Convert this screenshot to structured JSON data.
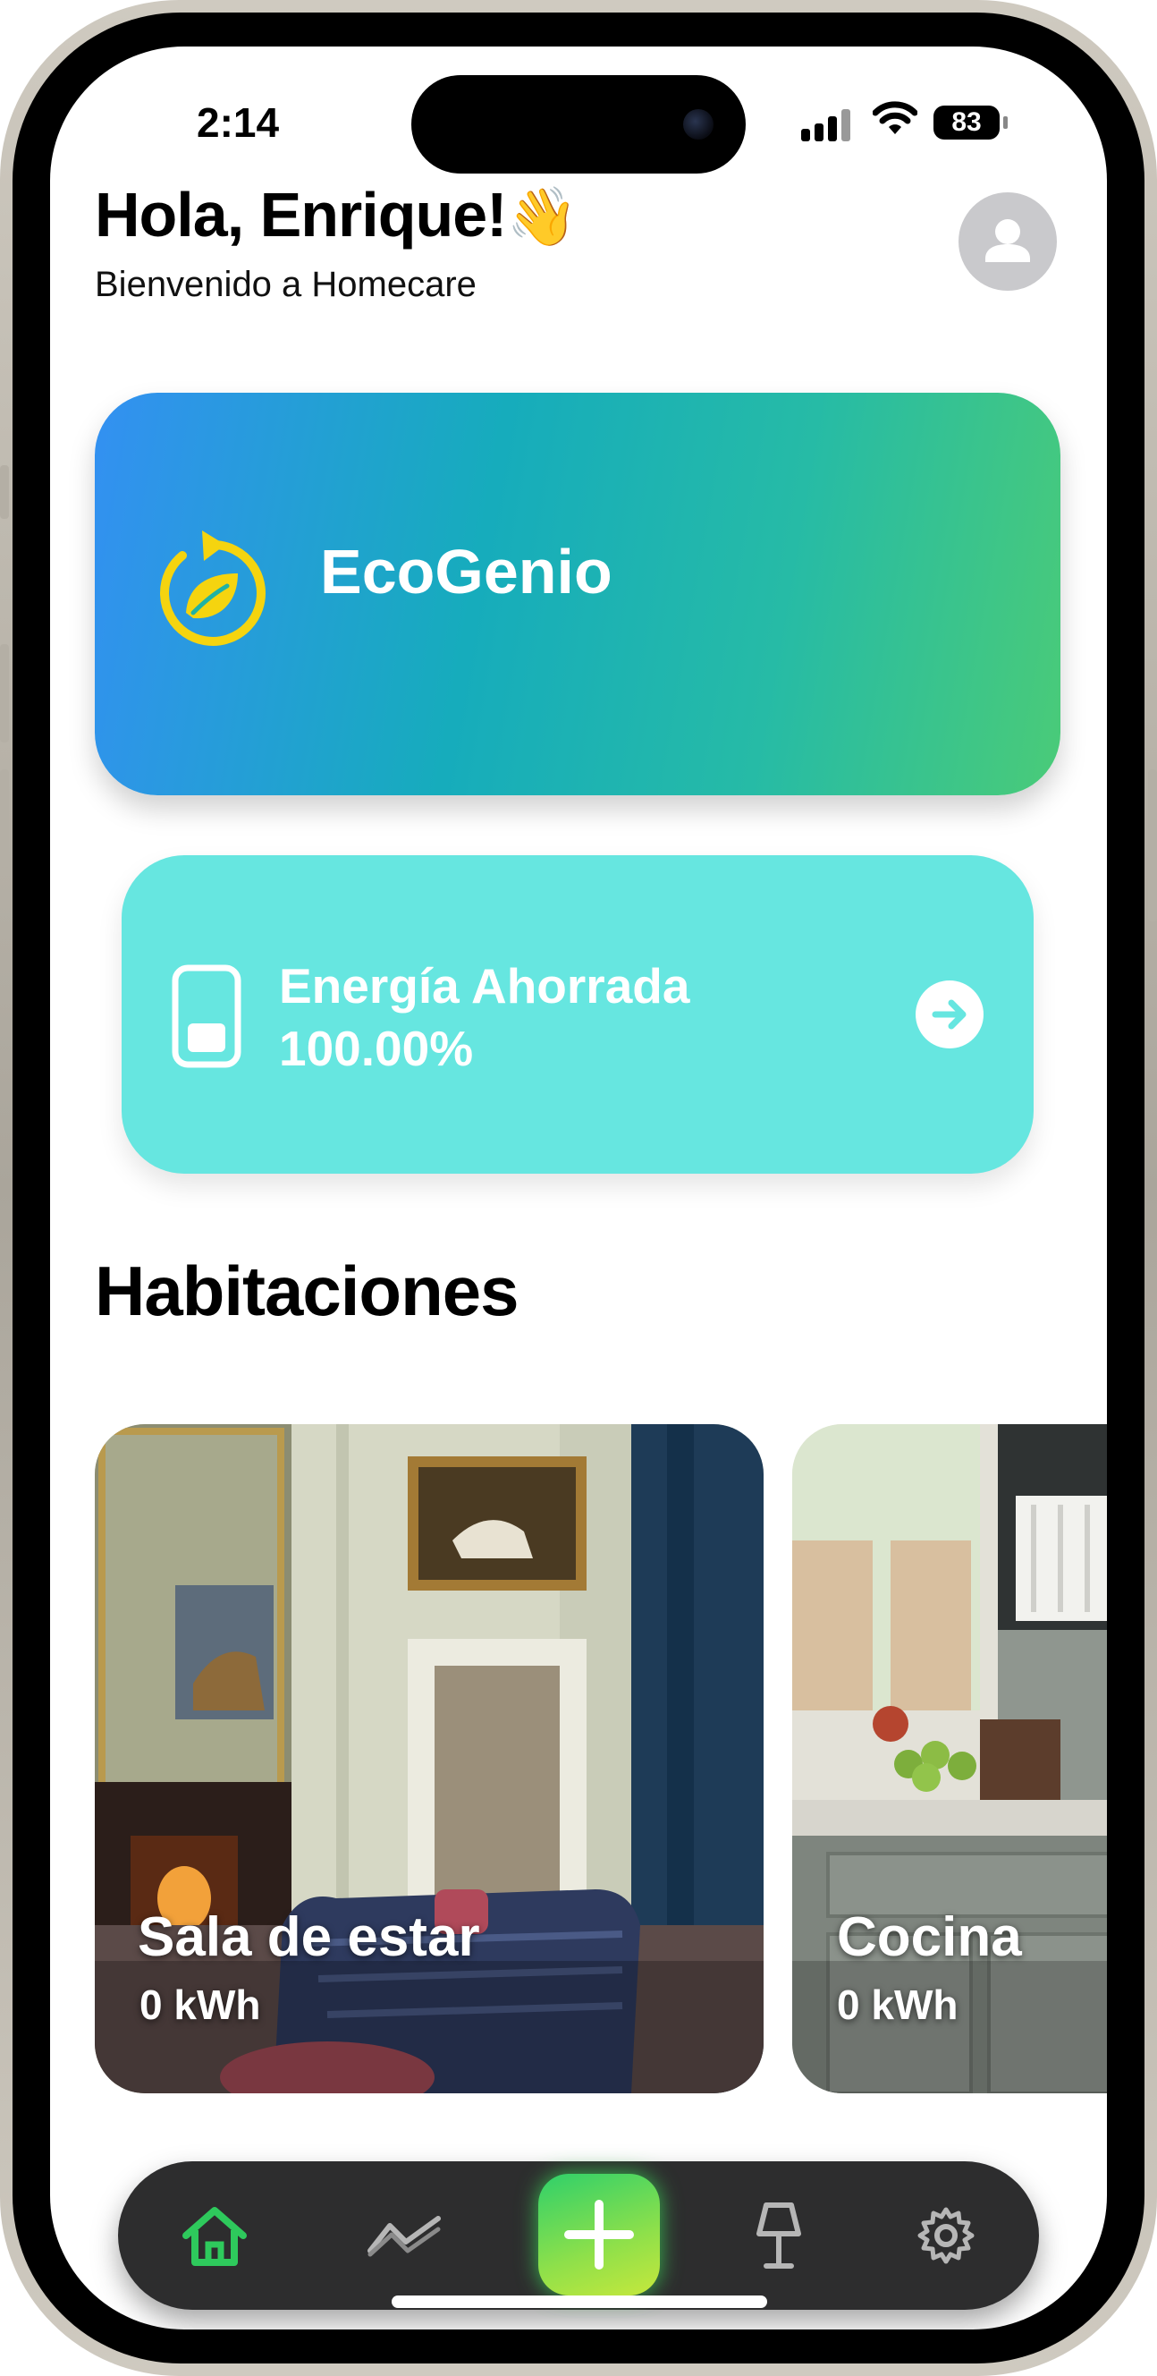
{
  "status_bar": {
    "time": "2:14",
    "battery": "83"
  },
  "header": {
    "greeting": "Hola, Enrique!",
    "wave_emoji": "👋",
    "subtitle": "Bienvenido a Homecare"
  },
  "eco_card": {
    "title": "EcoGenio",
    "icon": "eco-refresh-leaf-icon",
    "accent": "#f5d40f"
  },
  "energy_card": {
    "label": "Energía Ahorrada",
    "value": "100.00%",
    "icon": "phone-battery-icon"
  },
  "rooms": {
    "section_title": "Habitaciones",
    "items": [
      {
        "name": "Sala de estar",
        "energy": "0 kWh"
      },
      {
        "name": "Cocina",
        "energy": "0 kWh"
      }
    ]
  },
  "tab_bar": {
    "tabs": [
      {
        "icon": "home-icon",
        "active": true
      },
      {
        "icon": "chart-icon",
        "active": false
      },
      {
        "icon": "add-icon",
        "active": false
      },
      {
        "icon": "lamp-icon",
        "active": false
      },
      {
        "icon": "gear-icon",
        "active": false
      }
    ],
    "active_color": "#2ec95c"
  }
}
